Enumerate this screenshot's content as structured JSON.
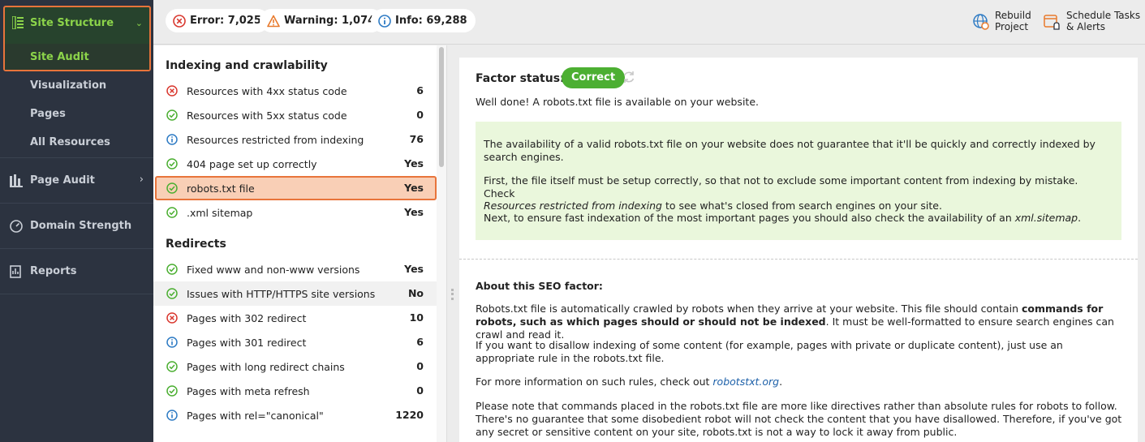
{
  "sidebar": {
    "site_structure": "Site Structure",
    "site_audit": "Site Audit",
    "sub_items": [
      "Visualization",
      "Pages",
      "All Resources"
    ],
    "page_audit": "Page Audit",
    "domain_strength": "Domain Strength",
    "reports": "Reports"
  },
  "topbar": {
    "error": "Error: 7,025",
    "warning": "Warning: 1,074",
    "info": "Info: 69,288",
    "rebuild_1": "Rebuild",
    "rebuild_2": "Project",
    "schedule_1": "Schedule Tasks",
    "schedule_2": "& Alerts"
  },
  "list": {
    "section1": "Indexing and crawlability",
    "section1_items": [
      {
        "status": "error",
        "label": "Resources with 4xx status code",
        "value": "6"
      },
      {
        "status": "ok",
        "label": "Resources with 5xx status code",
        "value": "0"
      },
      {
        "status": "info",
        "label": "Resources restricted from indexing",
        "value": "76"
      },
      {
        "status": "ok",
        "label": "404 page set up correctly",
        "value": "Yes"
      },
      {
        "status": "ok",
        "label": "robots.txt file",
        "value": "Yes"
      },
      {
        "status": "ok",
        "label": ".xml sitemap",
        "value": "Yes"
      }
    ],
    "section2": "Redirects",
    "section2_items": [
      {
        "status": "ok",
        "label": "Fixed www and non-www versions",
        "value": "Yes"
      },
      {
        "status": "ok",
        "label": "Issues with HTTP/HTTPS site versions",
        "value": "No"
      },
      {
        "status": "error",
        "label": "Pages with 302 redirect",
        "value": "10"
      },
      {
        "status": "info",
        "label": "Pages with 301 redirect",
        "value": "6"
      },
      {
        "status": "ok",
        "label": "Pages with long redirect chains",
        "value": "0"
      },
      {
        "status": "ok",
        "label": "Pages with meta refresh",
        "value": "0"
      },
      {
        "status": "info",
        "label": "Pages with rel=\"canonical\"",
        "value": "1220"
      }
    ]
  },
  "panel": {
    "factor_label": "Factor status:",
    "badge": "Correct",
    "summary": "Well done! A robots.txt file is available on your website.",
    "green_p1": "The availability of a valid robots.txt file on your website does not guarantee that it'll be quickly and correctly indexed by search engines.",
    "green_p2a": "First, the file itself must be setup correctly, so that not to exclude some important content from indexing by mistake. Check",
    "green_p2_em": "Resources restricted from indexing",
    "green_p2b": " to see what's closed from search engines on your site.",
    "green_p3a": "Next, to ensure fast indexation of the most important pages you should also check the availability of an ",
    "green_p3_em": "xml.sitemap",
    "green_p3b": ".",
    "about_title": "About this SEO factor:",
    "about_p1a": "Robots.txt file is automatically crawled by robots when they arrive at your website. This file should contain ",
    "about_p1_b": "commands for robots, such as which pages should or should not be indexed",
    "about_p1c": ". It must be well-formatted to ensure search engines can crawl and read it.",
    "about_p2": "If you want to disallow indexing of some content (for example, pages with private or duplicate content), just use an appropriate rule in the robots.txt file.",
    "about_p3a": "For more information on such rules, check out ",
    "about_p3_link": "robotstxt.org",
    "about_p3b": ".",
    "about_p4": "Please note that commands placed in the robots.txt file are more like directives rather than absolute rules for robots to follow. There's no guarantee that some disobedient robot will not check the content that you have disallowed. Therefore, if you've got any secret or sensitive content on your site, robots.txt is not a way to lock it away from public."
  },
  "colors": {
    "error": "#d9382f",
    "warning": "#e87a2c",
    "info": "#2e7bc4",
    "ok": "#4caf32",
    "accent": "#e8743b"
  }
}
